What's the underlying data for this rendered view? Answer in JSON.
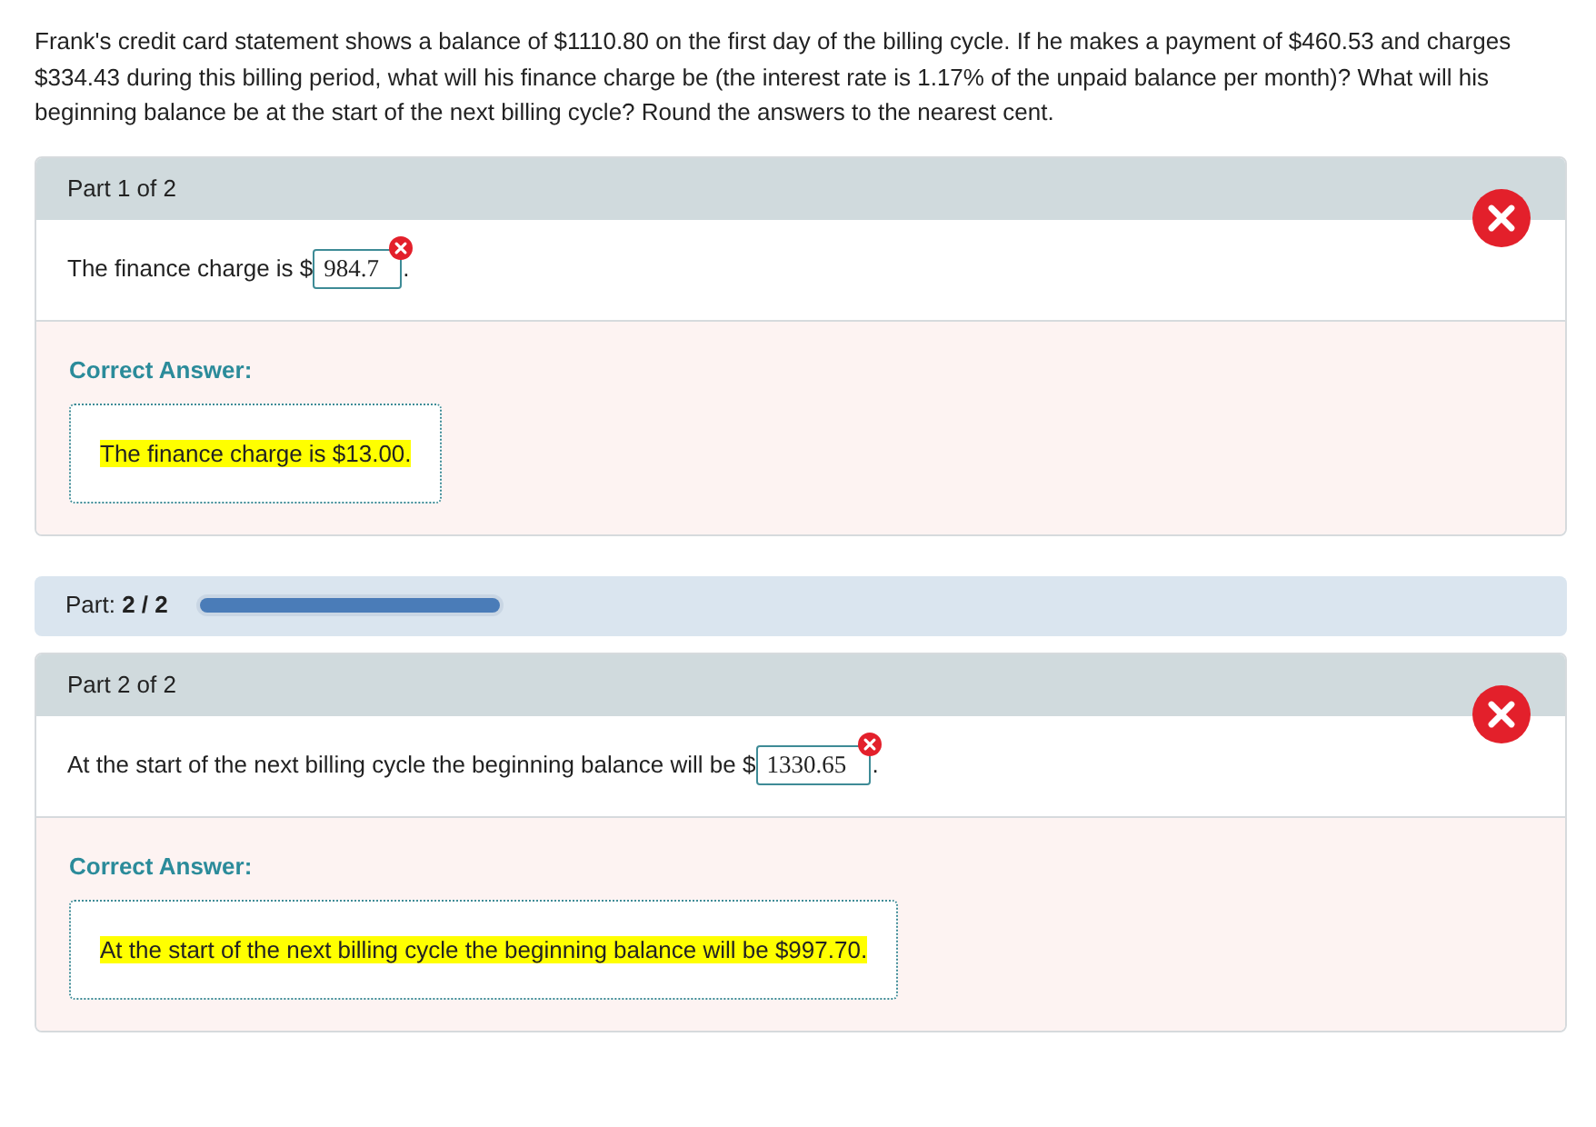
{
  "question": "Frank's credit card statement shows a balance of $1110.80 on the first day of the billing cycle. If he makes a payment of $460.53 and charges $334.43 during this billing period, what will his finance charge be (the interest rate is 1.17% of the unpaid balance per month)? What will his beginning balance be at the start of the next billing cycle? Round the answers to the nearest cent.",
  "sections": [
    {
      "kind": "part",
      "title": "Part 1 of 2",
      "correct": false,
      "prompt": "The finance charge is $",
      "answer_value": "984.7",
      "prompt_end": ".",
      "correct_answer_label": "Correct Answer:",
      "correct_answer": "The finance charge is $13.00.",
      "highlighted": true
    },
    {
      "kind": "progress",
      "label": "Part: **2 / 2**",
      "level": 1
    },
    {
      "kind": "part",
      "title": "Part 2 of 2",
      "correct": false,
      "prompt": "At the start of the next billing cycle the beginning balance will be $",
      "answer_value": "1330.65",
      "prompt_end": ".",
      "correct_answer_label": "Correct Answer:",
      "correct_answer": "At the start of the next billing cycle the beginning balance will be $997.70.",
      "highlighted": true
    }
  ]
}
